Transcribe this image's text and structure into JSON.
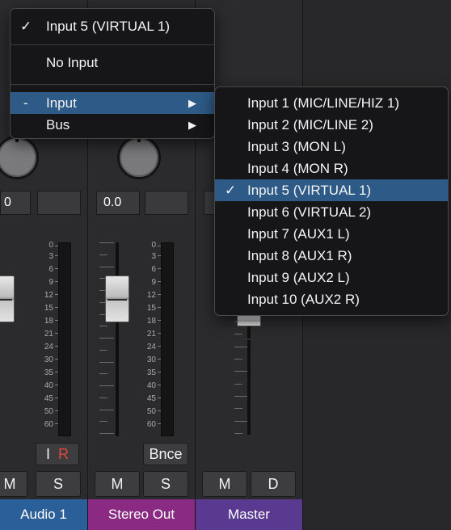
{
  "mixer": {
    "strips": [
      {
        "name": "Audio 1",
        "value": "0",
        "ir": [
          "I",
          "R"
        ],
        "buttons": [
          "M",
          "S"
        ],
        "color": "#2a5f9a"
      },
      {
        "name": "Stereo Out",
        "value": "0.0",
        "bnce": "Bnce",
        "buttons": [
          "M",
          "S"
        ],
        "color": "#8a2a82"
      },
      {
        "name": "Master",
        "buttons": [
          "M",
          "D"
        ],
        "color": "#5a3a90"
      }
    ],
    "meter_scale": [
      "0",
      "3",
      "6",
      "9",
      "12",
      "15",
      "18",
      "21",
      "24",
      "30",
      "35",
      "40",
      "45",
      "50",
      "60"
    ]
  },
  "main_menu": {
    "items": [
      {
        "check": "✓",
        "label": "Input 5  (VIRTUAL 1)"
      },
      {
        "label": "No Input"
      },
      {
        "prefix": "-",
        "label": "Input",
        "arrow": "▶",
        "highlighted": true
      },
      {
        "label": "Bus",
        "arrow": "▶"
      }
    ]
  },
  "submenu": {
    "items": [
      {
        "label": "Input 1  (MIC/LINE/HIZ 1)"
      },
      {
        "label": "Input 2  (MIC/LINE 2)"
      },
      {
        "label": "Input 3  (MON L)"
      },
      {
        "label": "Input 4  (MON R)"
      },
      {
        "label": "Input 5  (VIRTUAL 1)",
        "check": "✓",
        "selected": true
      },
      {
        "label": "Input 6  (VIRTUAL 2)"
      },
      {
        "label": "Input 7  (AUX1 L)"
      },
      {
        "label": "Input 8  (AUX1 R)"
      },
      {
        "label": "Input 9  (AUX2 L)"
      },
      {
        "label": "Input 10  (AUX2 R)"
      }
    ]
  }
}
